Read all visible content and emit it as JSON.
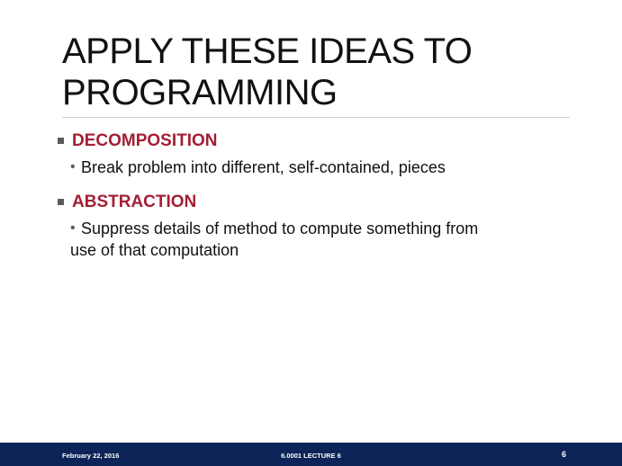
{
  "slide": {
    "title_line1": "APPLY THESE IDEAS TO",
    "title_line2": "PROGRAMMING",
    "bullets": [
      {
        "heading": "DECOMPOSITION",
        "sub": "Break problem into different, self-contained, pieces"
      },
      {
        "heading": "ABSTRACTION",
        "sub_line1": "Suppress details of method to compute something from",
        "sub_line2": "use of that computation"
      }
    ]
  },
  "footer": {
    "date": "February 22, 2016",
    "course": "6.0001 LECTURE 6",
    "page": "6"
  },
  "colors": {
    "heading": "#a31f34",
    "footer_bg": "#0c2457",
    "text": "#111111"
  },
  "icons": {
    "level1_marker": "square-bullet-icon",
    "level2_marker": "dot-bullet-icon"
  }
}
